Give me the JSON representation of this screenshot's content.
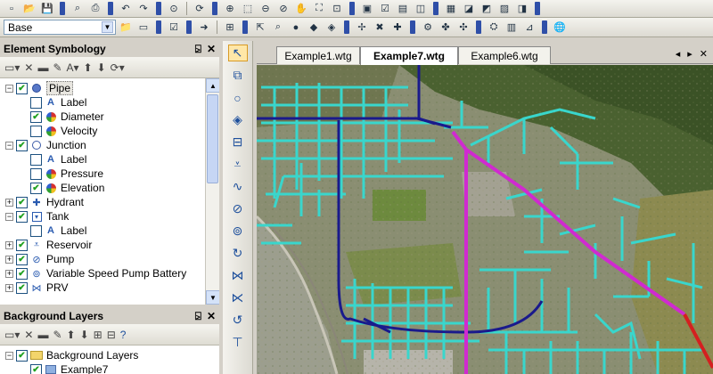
{
  "toolbar": {
    "scenario_value": "Base"
  },
  "element_symbology": {
    "title": "Element Symbology",
    "pin_glyph": "⍄",
    "close_glyph": "✕",
    "items": [
      {
        "label": "Pipe",
        "level": 0,
        "expander": "−",
        "checked": true,
        "icon": "pipe-icon",
        "selected": true
      },
      {
        "label": "Label",
        "level": 1,
        "checked": false,
        "icon": "label-icon"
      },
      {
        "label": "Diameter",
        "level": 1,
        "checked": true,
        "icon": "color-coding-icon"
      },
      {
        "label": "Velocity",
        "level": 1,
        "checked": false,
        "icon": "color-coding-icon"
      },
      {
        "label": "Junction",
        "level": 0,
        "expander": "−",
        "checked": true,
        "icon": "junction-icon"
      },
      {
        "label": "Label",
        "level": 1,
        "checked": false,
        "icon": "label-icon"
      },
      {
        "label": "Pressure",
        "level": 1,
        "checked": false,
        "icon": "color-coding-icon"
      },
      {
        "label": "Elevation",
        "level": 1,
        "checked": true,
        "icon": "color-coding-icon"
      },
      {
        "label": "Hydrant",
        "level": 0,
        "expander": "+",
        "checked": true,
        "icon": "hydrant-icon"
      },
      {
        "label": "Tank",
        "level": 0,
        "expander": "−",
        "checked": true,
        "icon": "tank-icon"
      },
      {
        "label": "Label",
        "level": 1,
        "checked": false,
        "icon": "label-icon"
      },
      {
        "label": "Reservoir",
        "level": 0,
        "expander": "+",
        "checked": true,
        "icon": "reservoir-icon"
      },
      {
        "label": "Pump",
        "level": 0,
        "expander": "+",
        "checked": true,
        "icon": "pump-icon"
      },
      {
        "label": "Variable Speed Pump Battery",
        "level": 0,
        "expander": "+",
        "checked": true,
        "icon": "pump-battery-icon"
      },
      {
        "label": "PRV",
        "level": 0,
        "expander": "+",
        "checked": true,
        "icon": "prv-icon"
      }
    ]
  },
  "background_layers": {
    "title": "Background Layers",
    "pin_glyph": "⍄",
    "close_glyph": "✕",
    "items": [
      {
        "label": "Background Layers",
        "level": 0,
        "expander": "−",
        "checked": true,
        "icon": "folder-icon"
      },
      {
        "label": "Example7",
        "level": 1,
        "checked": true,
        "icon": "layer-icon"
      }
    ]
  },
  "document_tabs": [
    {
      "label": "Example1.wtg",
      "active": false
    },
    {
      "label": "Example7.wtg",
      "active": true
    },
    {
      "label": "Example6.wtg",
      "active": false
    }
  ],
  "tab_nav": {
    "prev": "◂",
    "next": "▸",
    "close": "✕"
  },
  "colors": {
    "transmission_main": "#1a1a8c",
    "distribution_pipes": "#39d6cc",
    "highlighted_main": "#d02ad0",
    "red_main": "#d42020",
    "accent_grip": "#2f4fa8"
  }
}
